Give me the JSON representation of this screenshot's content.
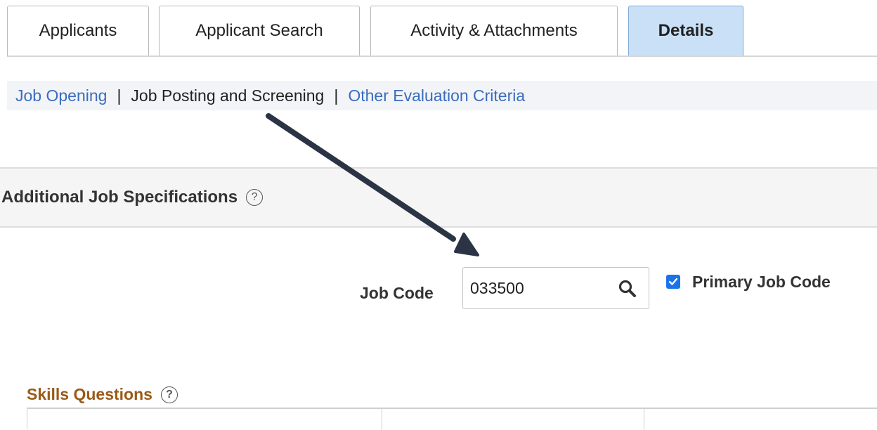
{
  "tabs": [
    {
      "label": "Applicants",
      "active": false
    },
    {
      "label": "Applicant Search",
      "active": false
    },
    {
      "label": "Activity & Attachments",
      "active": false
    },
    {
      "label": "Details",
      "active": true
    }
  ],
  "subnav": {
    "job_opening": "Job Opening",
    "separator": "|",
    "job_posting": "Job Posting and Screening",
    "other_eval": "Other Evaluation Criteria"
  },
  "section": {
    "title": "Additional Job Specifications",
    "help_glyph": "?"
  },
  "job_code": {
    "label": "Job Code",
    "value": "033500",
    "lookup_icon": "search-icon",
    "primary_label": "Primary Job Code",
    "primary_checked": true
  },
  "skills": {
    "title": "Skills Questions",
    "help_glyph": "?"
  },
  "colors": {
    "active_tab": "#c9e0f7",
    "link": "#3a6cbf",
    "skills_title": "#9a5a17",
    "checkbox": "#1a73e8",
    "arrow": "#2b3445"
  }
}
